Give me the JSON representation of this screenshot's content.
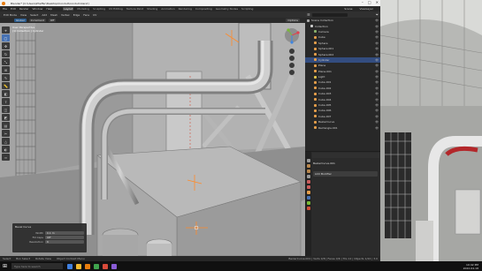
{
  "window": {
    "title": "Blender* [C:\\Users\\Zheffer\\Desktop\\Conduit\\conduit.blend]"
  },
  "window_controls": [
    "–",
    "□",
    "✕"
  ],
  "menu": [
    "File",
    "Edit",
    "Render",
    "Window",
    "Help"
  ],
  "workspaces": [
    {
      "label": "Layout",
      "active": true
    },
    {
      "label": "Modeling",
      "active": false
    },
    {
      "label": "Sculpting",
      "active": false
    },
    {
      "label": "UV Editing",
      "active": false
    },
    {
      "label": "Texture Paint",
      "active": false
    },
    {
      "label": "Shading",
      "active": false
    },
    {
      "label": "Animation",
      "active": false
    },
    {
      "label": "Rendering",
      "active": false
    },
    {
      "label": "Compositing",
      "active": false
    },
    {
      "label": "Geometry Nodes",
      "active": false
    },
    {
      "label": "Scripting",
      "active": false
    }
  ],
  "scene": {
    "label": "Scene",
    "view_layer": "ViewLayer"
  },
  "editor_header": [
    "Edit Mode",
    "View",
    "Select",
    "Add",
    "Mesh",
    "Vertex",
    "Edge",
    "Face",
    "UV"
  ],
  "tool_header": {
    "items": [
      "Global",
      "Options"
    ],
    "orientation": "Global",
    "snap": "Increment",
    "proportional": "Off"
  },
  "viewport_overlay": [
    "User Perspective",
    "(1) Collection | Cylinder"
  ],
  "tools": [
    {
      "icon": "cursor-icon",
      "glyph": "⌖",
      "active": false
    },
    {
      "icon": "select-box-icon",
      "glyph": "▢",
      "active": true
    },
    {
      "icon": "move-icon",
      "glyph": "✥",
      "active": false
    },
    {
      "icon": "rotate-icon",
      "glyph": "↻",
      "active": false
    },
    {
      "icon": "scale-icon",
      "glyph": "⤡",
      "active": false
    },
    {
      "icon": "transform-icon",
      "glyph": "⊞",
      "active": false
    },
    {
      "icon": "annotate-icon",
      "glyph": "✎",
      "active": false
    },
    {
      "icon": "measure-icon",
      "glyph": "📏",
      "active": false
    },
    {
      "icon": "add-cube-icon",
      "glyph": "◧",
      "active": false
    },
    {
      "icon": "extrude-icon",
      "glyph": "⇪",
      "active": false
    },
    {
      "icon": "inset-icon",
      "glyph": "◫",
      "active": false
    },
    {
      "icon": "bevel-icon",
      "glyph": "◩",
      "active": false
    },
    {
      "icon": "loop-cut-icon",
      "glyph": "▤",
      "active": false
    },
    {
      "icon": "knife-icon",
      "glyph": "✂",
      "active": false
    },
    {
      "icon": "poly-build-icon",
      "glyph": "△",
      "active": false
    },
    {
      "icon": "spin-icon",
      "glyph": "◐",
      "active": false
    },
    {
      "icon": "smooth-icon",
      "glyph": "≈",
      "active": false
    }
  ],
  "last_operator": {
    "title": "Bevel Curve",
    "rows": [
      {
        "label": "Width",
        "value": "0.1 m"
      },
      {
        "label": "Fill Caps",
        "value": "Off"
      },
      {
        "label": "Resolution",
        "value": "6"
      }
    ]
  },
  "outliner": {
    "search_placeholder": "",
    "rows": [
      {
        "label": "Scene Collection",
        "indent": 0,
        "color": "#aaaaaa",
        "selected": false,
        "mod": ""
      },
      {
        "label": "Collection",
        "indent": 1,
        "color": "#cccccc",
        "selected": false,
        "mod": ""
      },
      {
        "label": "Camera",
        "indent": 2,
        "color": "#89b06c",
        "selected": false,
        "mod": ""
      },
      {
        "label": "Cube",
        "indent": 2,
        "color": "#e59e4a",
        "selected": false,
        "mod": ""
      },
      {
        "label": "Sphere",
        "indent": 2,
        "color": "#e59e4a",
        "selected": false,
        "mod": ""
      },
      {
        "label": "Sphere.001",
        "indent": 2,
        "color": "#e59e4a",
        "selected": false,
        "mod": ""
      },
      {
        "label": "Sphere.002",
        "indent": 2,
        "color": "#e59e4a",
        "selected": false,
        "mod": ""
      },
      {
        "label": "Cylinder",
        "indent": 2,
        "color": "#e59e4a",
        "selected": true,
        "mod": ""
      },
      {
        "label": "Plane",
        "indent": 2,
        "color": "#e59e4a",
        "selected": false,
        "mod": ""
      },
      {
        "label": "Plane.001",
        "indent": 2,
        "color": "#e59e4a",
        "selected": false,
        "mod": ""
      },
      {
        "label": "Light",
        "indent": 2,
        "color": "#e0c34a",
        "selected": false,
        "mod": ""
      },
      {
        "label": "Cube.001",
        "indent": 2,
        "color": "#e59e4a",
        "selected": false,
        "mod": ""
      },
      {
        "label": "Cube.002",
        "indent": 2,
        "color": "#e59e4a",
        "selected": false,
        "mod": ""
      },
      {
        "label": "Cube.003",
        "indent": 2,
        "color": "#e59e4a",
        "selected": false,
        "mod": ""
      },
      {
        "label": "Cube.004",
        "indent": 2,
        "color": "#e59e4a",
        "selected": false,
        "mod": ""
      },
      {
        "label": "Cube.005",
        "indent": 2,
        "color": "#e59e4a",
        "selected": false,
        "mod": ""
      },
      {
        "label": "Cube.006",
        "indent": 2,
        "color": "#e59e4a",
        "selected": false,
        "mod": ""
      },
      {
        "label": "Cube.007",
        "indent": 2,
        "color": "#e59e4a",
        "selected": false,
        "mod": ""
      },
      {
        "label": "BezierCurve",
        "indent": 2,
        "color": "#e59e4a",
        "selected": false,
        "mod": ""
      },
      {
        "label": "Rectangle.001",
        "indent": 2,
        "color": "#e59e4a",
        "selected": false,
        "mod": ""
      }
    ]
  },
  "properties": {
    "object_name": "BezierCurve.001",
    "add_modifier": "Add Modifier"
  },
  "statusbar": {
    "left": [
      "Select",
      "Box Select",
      "Rotate View",
      "Object Context Menu"
    ],
    "right": "BezierCurve.001 | Verts 0/8 | Faces 0/6 | Tris 12 | Objects 1/22 | 3.0"
  },
  "taskbar": {
    "search_placeholder": "Type here to search",
    "apps": [
      "#3f7fdf",
      "#f1b92f",
      "#e87d0d",
      "#3fa34d",
      "#d84a3a",
      "#8a5cd6"
    ],
    "time": "10:42 PM",
    "date": "2022-04-18"
  },
  "colors": {
    "accent": "#4772b3",
    "selection": "#334d80",
    "object": "#e59e4a"
  }
}
